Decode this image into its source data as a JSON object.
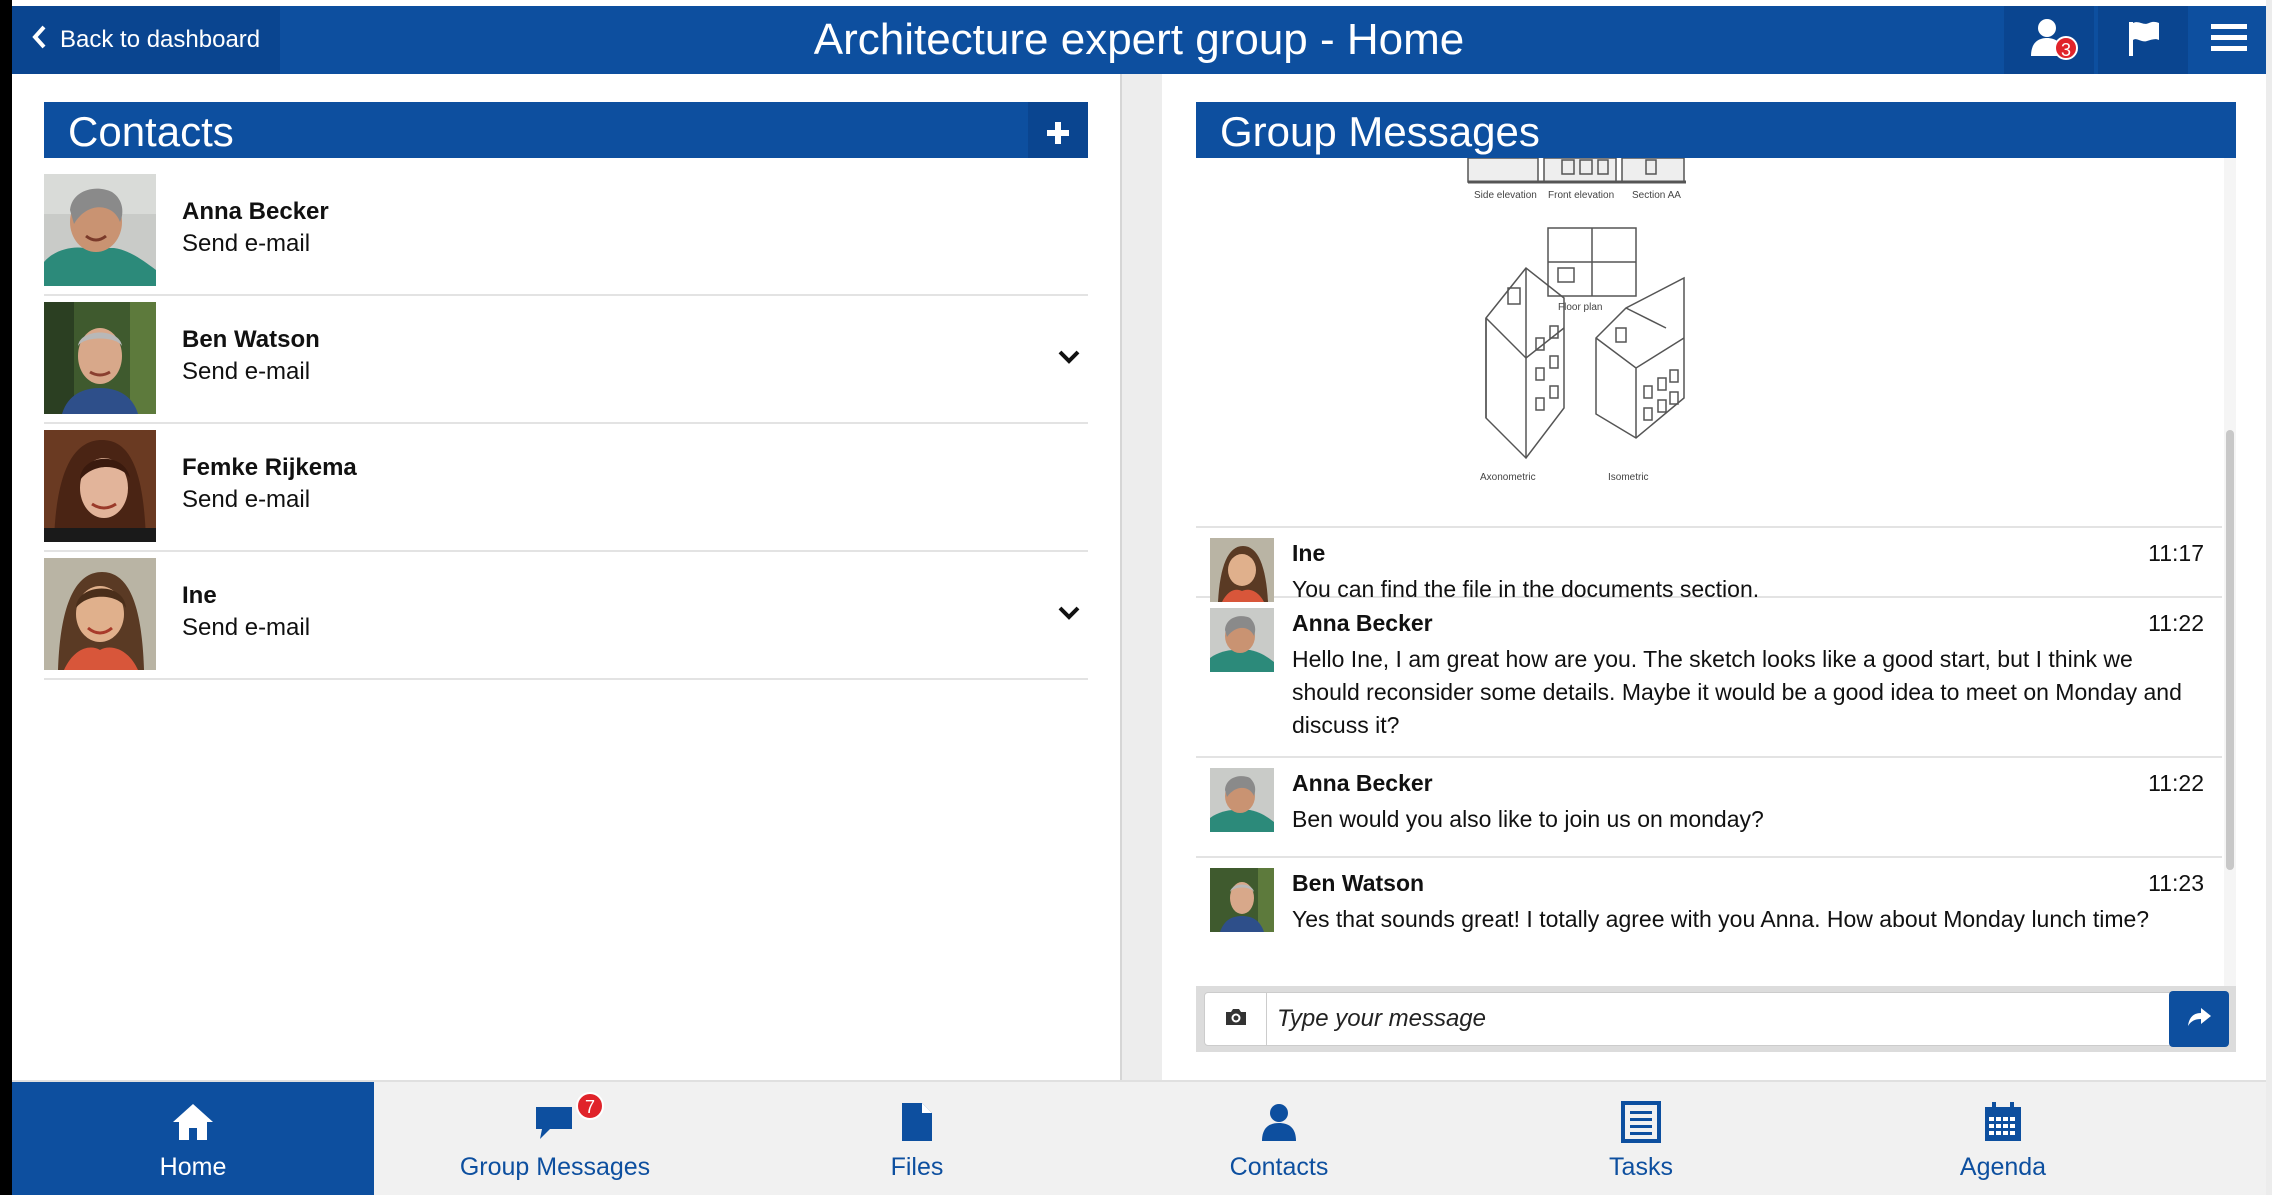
{
  "header": {
    "back_label": "Back to dashboard",
    "title": "Architecture expert group - Home",
    "notification_count": "3"
  },
  "contacts": {
    "title": "Contacts",
    "items": [
      {
        "name": "Anna Becker",
        "action": "Send e-mail"
      },
      {
        "name": "Ben Watson",
        "action": "Send e-mail"
      },
      {
        "name": "Femke Rijkema",
        "action": "Send e-mail"
      },
      {
        "name": "Ine",
        "action": "Send e-mail"
      }
    ]
  },
  "messages": {
    "title": "Group Messages",
    "sketch_labels": {
      "side": "Side elevation",
      "front": "Front elevation",
      "section": "Section AA",
      "floor": "Floor plan",
      "axo": "Axonometric",
      "iso": "Isometric"
    },
    "items": [
      {
        "sender": "Ine",
        "time": "11:17",
        "text": "You can find the file in the documents section."
      },
      {
        "sender": "Anna Becker",
        "time": "11:22",
        "text": "Hello Ine, I am great how are you. The sketch looks like a good start, but I think we should reconsider some details. Maybe it would be a good idea to meet on Monday and discuss it?"
      },
      {
        "sender": "Anna Becker",
        "time": "11:22",
        "text": "Ben would you also like to join us on monday?"
      },
      {
        "sender": "Ben Watson",
        "time": "11:23",
        "text": "Yes that sounds great! I totally agree with you Anna. How about Monday lunch time?"
      }
    ],
    "input_placeholder": "Type your message"
  },
  "nav": {
    "items": [
      {
        "label": "Home",
        "icon": "home-icon"
      },
      {
        "label": "Group Messages",
        "icon": "chat-icon",
        "badge": "7"
      },
      {
        "label": "Files",
        "icon": "file-icon"
      },
      {
        "label": "Contacts",
        "icon": "person-icon"
      },
      {
        "label": "Tasks",
        "icon": "list-icon"
      },
      {
        "label": "Agenda",
        "icon": "calendar-icon"
      }
    ]
  },
  "colors": {
    "brand": "#0d4f9f",
    "badge": "#e0232a"
  }
}
